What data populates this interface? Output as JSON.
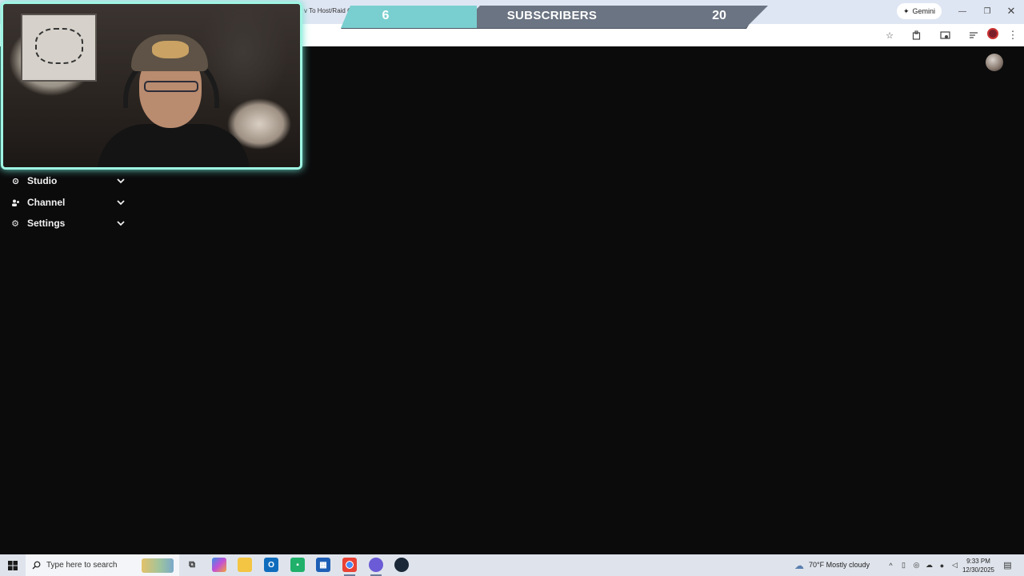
{
  "browser": {
    "tab_title": "v To Host/Raid On T",
    "gemini_label": "Gemini",
    "toolbar_icons": [
      "star-icon",
      "extensions-icon",
      "media-icon",
      "reading-list-icon",
      "profile-avatar",
      "menu-icon"
    ]
  },
  "overlay": {
    "left_count": "6",
    "label": "SUBSCRIBERS",
    "right_count": "20",
    "accent_color": "#79cfcf",
    "bar_color": "#6b7482"
  },
  "sidebar": {
    "items": [
      {
        "label": "Studio",
        "icon": "studio-icon"
      },
      {
        "label": "Channel",
        "icon": "channel-icon"
      },
      {
        "label": "Settings",
        "icon": "gear-icon"
      }
    ]
  },
  "taskbar": {
    "search_placeholder": "Type here to search",
    "weather": "70°F  Mostly cloudy",
    "time": "9:33 PM",
    "date": "12/30/2025"
  }
}
